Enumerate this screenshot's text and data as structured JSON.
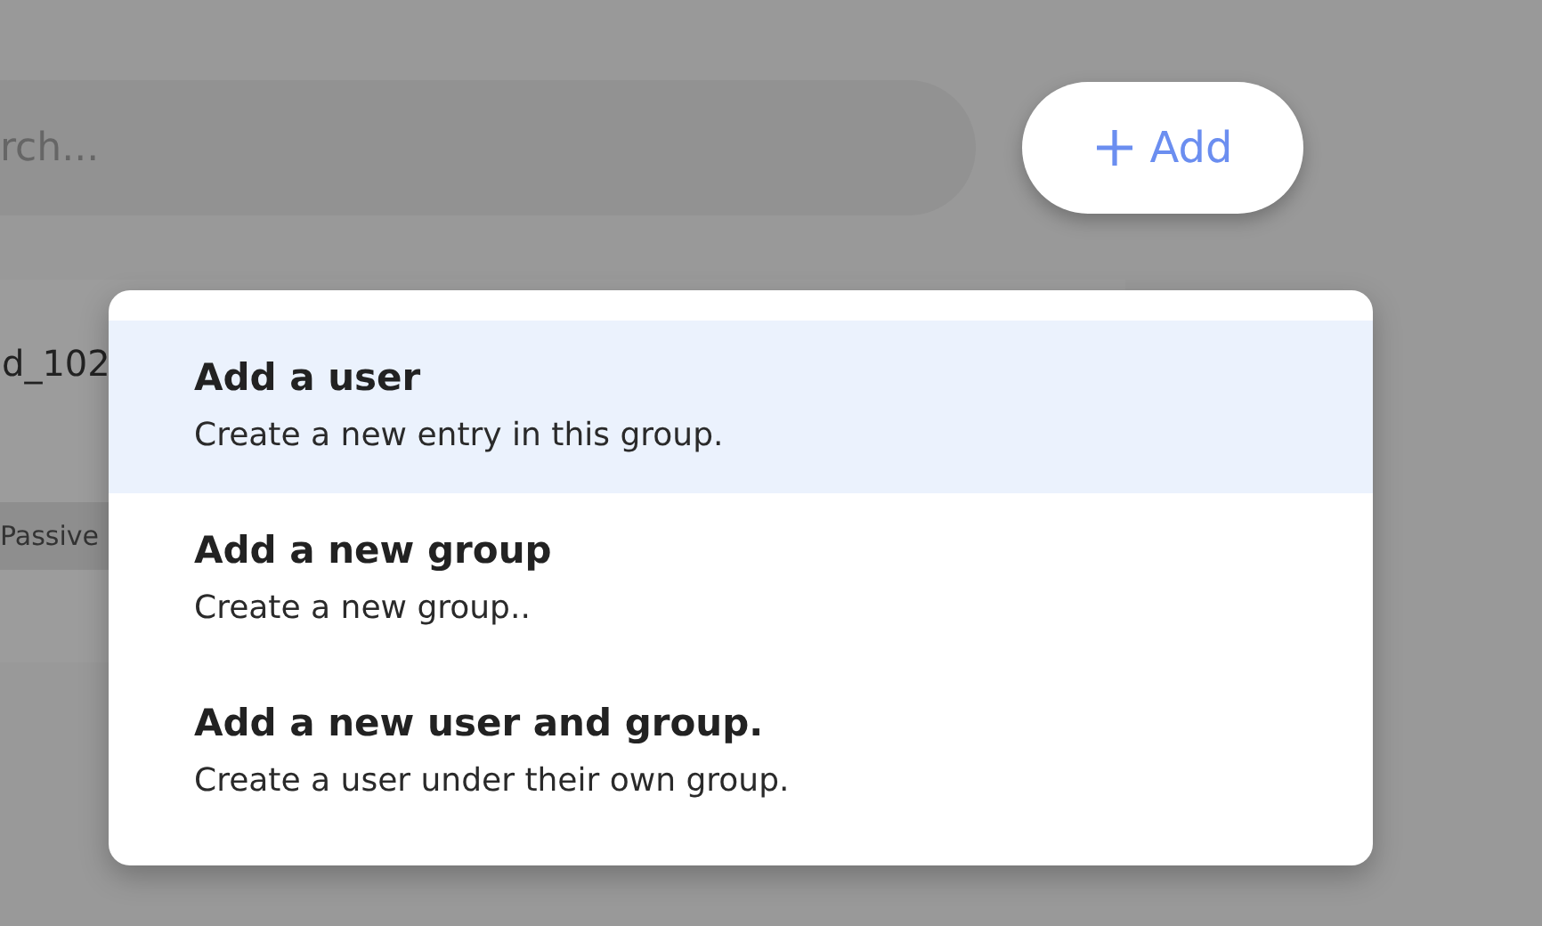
{
  "search": {
    "placeholder": "rch..."
  },
  "add_button": {
    "label": "Add"
  },
  "card": {
    "title": "d_102",
    "badge": "Passive"
  },
  "menu": {
    "items": [
      {
        "title": "Add a user",
        "description": "Create a new entry in this group.",
        "selected": true
      },
      {
        "title": "Add a new group",
        "description": "Create a new group..",
        "selected": false
      },
      {
        "title": "Add a new user and group.",
        "description": "Create a user under their own group.",
        "selected": false
      }
    ]
  }
}
